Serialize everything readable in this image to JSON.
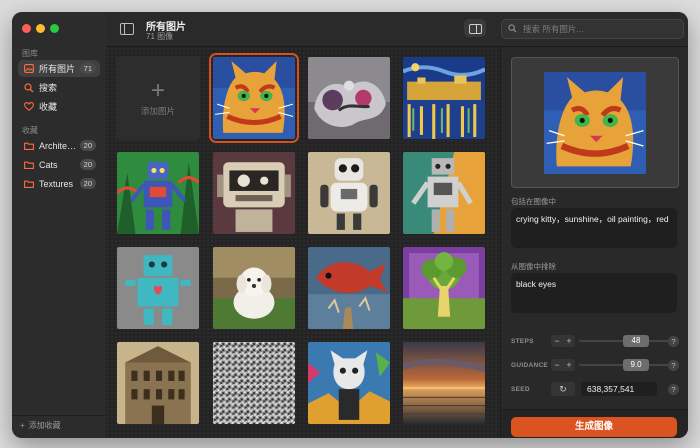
{
  "sidebar": {
    "library_title": "图库",
    "library_items": [
      {
        "label": "所有图片",
        "count": "71",
        "icon": "photo-icon"
      },
      {
        "label": "搜索",
        "icon": "search-icon"
      },
      {
        "label": "收藏",
        "icon": "heart-icon"
      }
    ],
    "collections_title": "收藏",
    "collections": [
      {
        "label": "Architecture",
        "count": "20"
      },
      {
        "label": "Cats",
        "count": "20"
      },
      {
        "label": "Textures",
        "count": "20"
      }
    ],
    "add_collection": "添加收藏"
  },
  "header": {
    "title": "所有图片",
    "subtitle": "71 图像",
    "search_placeholder": "搜索 所有图片..."
  },
  "grid": {
    "add_label": "添加图片"
  },
  "inspector": {
    "include_label": "包括在图像中",
    "include_text": "crying kitty，sunshine，oil painting，red",
    "exclude_label": "从图像中排除",
    "exclude_text": "black eyes",
    "steps_label": "STEPS",
    "steps_value": "48",
    "guidance_label": "GUIDANCE",
    "guidance_value": "9.0",
    "seed_label": "SEED",
    "seed_value": "638,357,541",
    "generate_label": "生成图像"
  },
  "colors": {
    "accent": "#dc5322",
    "window_bg": "#262626"
  }
}
